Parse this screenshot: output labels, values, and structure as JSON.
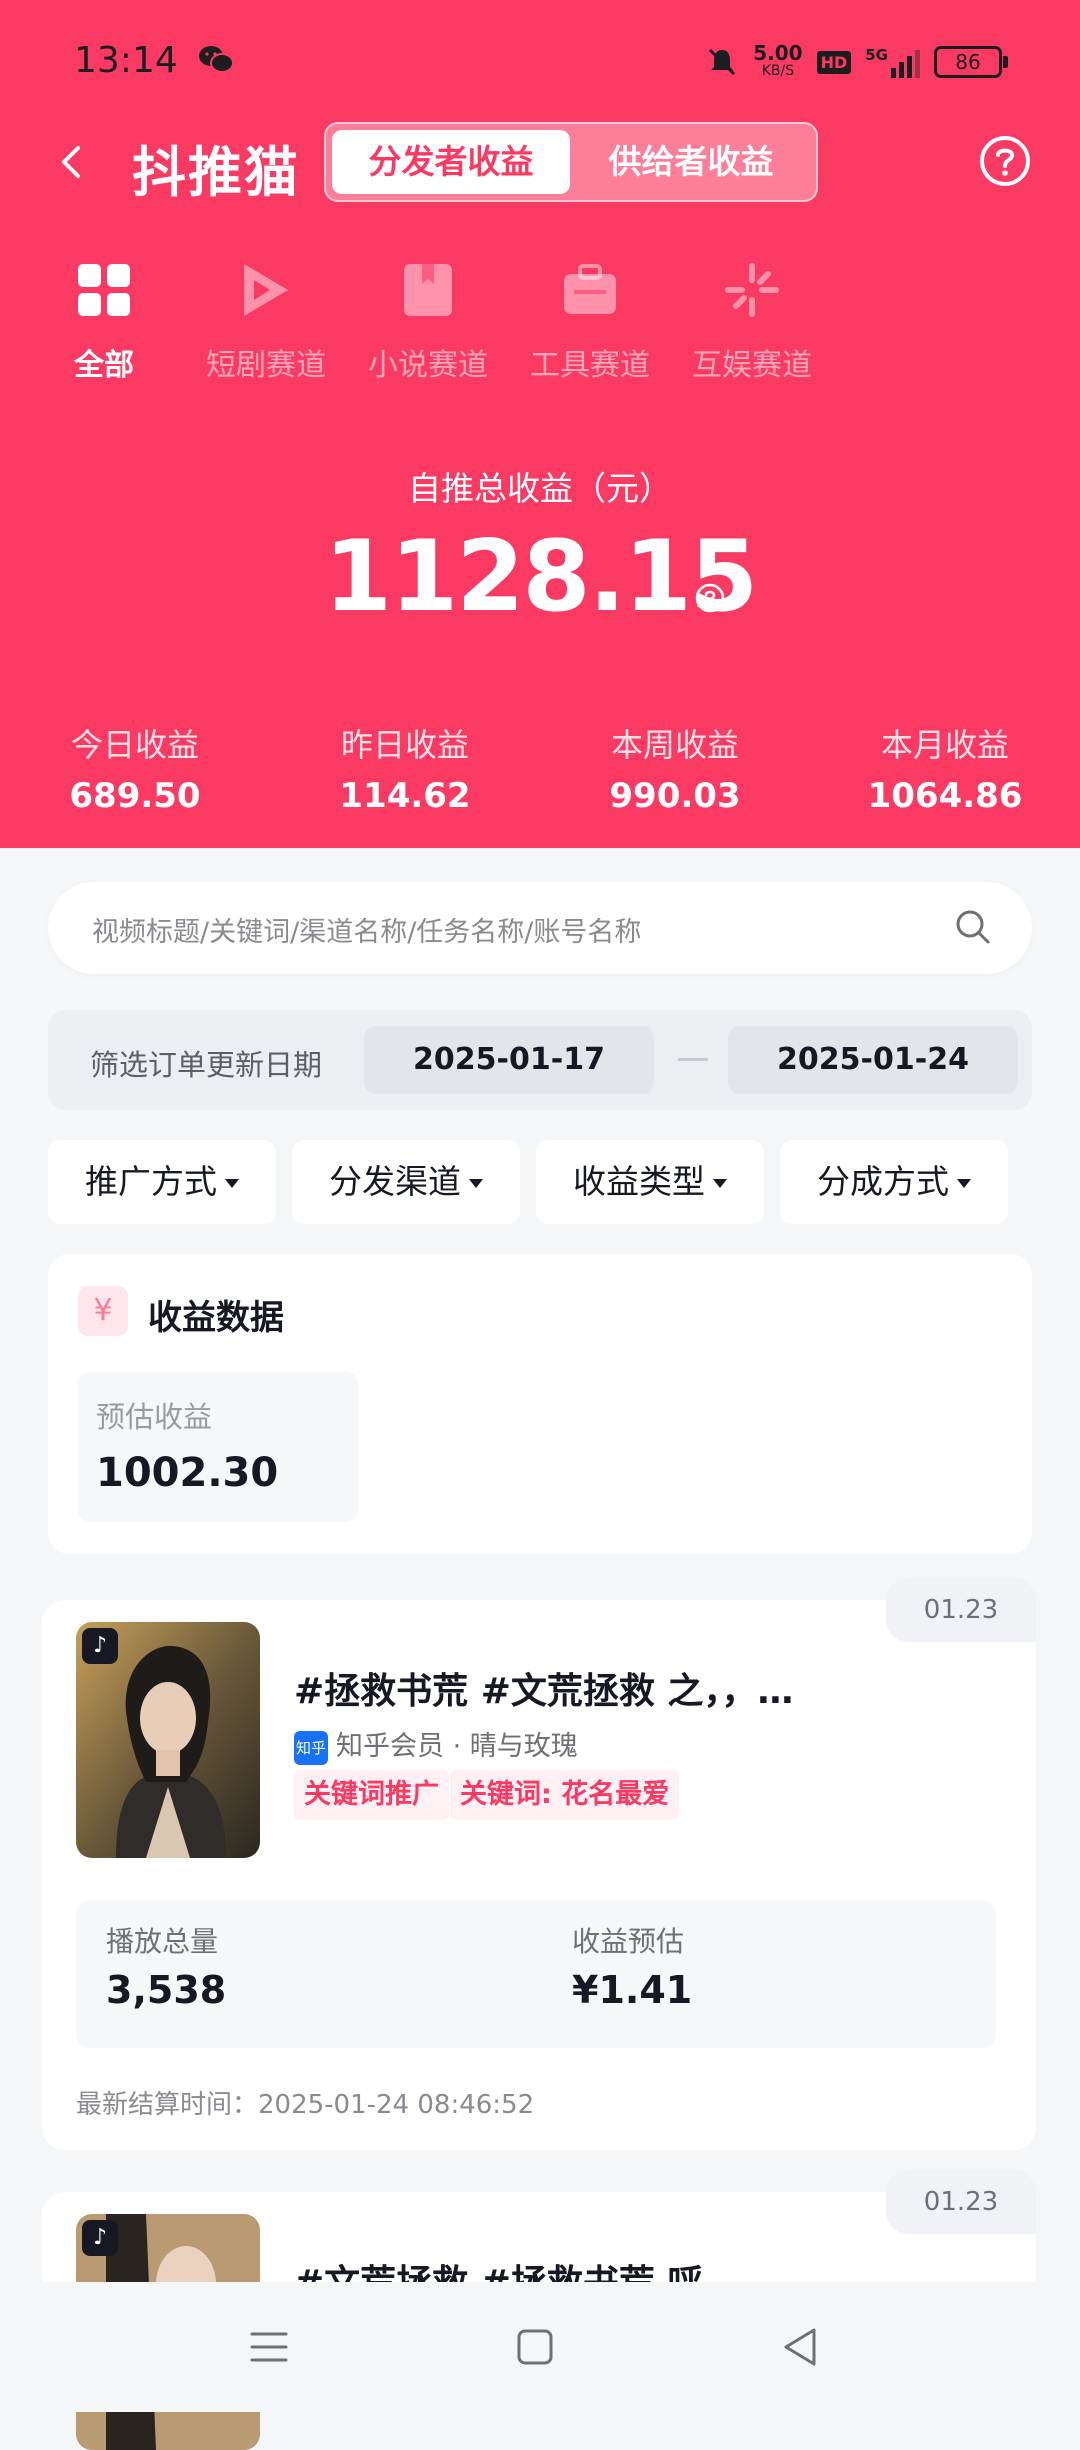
{
  "status_bar": {
    "time": "13:14",
    "net_speed": "5.00",
    "net_unit": "KB/S",
    "hd": "HD",
    "signal": "5G",
    "battery": "86"
  },
  "nav": {
    "logo": "抖推猫",
    "tabs": [
      {
        "label": "分发者收益",
        "active": true
      },
      {
        "label": "供给者收益",
        "active": false
      }
    ]
  },
  "categories": [
    {
      "label": "全部",
      "icon": "grid-icon",
      "active": true
    },
    {
      "label": "短剧赛道",
      "icon": "play-icon",
      "active": false
    },
    {
      "label": "小说赛道",
      "icon": "book-icon",
      "active": false
    },
    {
      "label": "工具赛道",
      "icon": "toolbox-icon",
      "active": false
    },
    {
      "label": "互娱赛道",
      "icon": "sparkle-icon",
      "active": false
    }
  ],
  "total": {
    "label": "自推总收益（元）",
    "value": "1128.15"
  },
  "stats": [
    {
      "label": "今日收益",
      "value": "689.50"
    },
    {
      "label": "昨日收益",
      "value": "114.62"
    },
    {
      "label": "本周收益",
      "value": "990.03"
    },
    {
      "label": "本月收益",
      "value": "1064.86"
    }
  ],
  "search": {
    "placeholder": "视频标题/关键词/渠道名称/任务名称/账号名称"
  },
  "date_filter": {
    "label": "筛选订单更新日期",
    "start": "2025-01-17",
    "end": "2025-01-24"
  },
  "filters": [
    "推广方式",
    "分发渠道",
    "收益类型",
    "分成方式"
  ],
  "earnings": {
    "yen": "¥",
    "title": "收益数据",
    "estimate_label": "预估收益",
    "estimate_value": "1002.30"
  },
  "cards": [
    {
      "date": "01.23",
      "title": "#拯救书荒 #文荒拯救 之，，…",
      "platform_badge": "知乎",
      "source": "知乎会员 · 晴与玫瑰",
      "tags": [
        "关键词推广",
        "关键词: 花名最爱"
      ],
      "plays_label": "播放总量",
      "plays_value": "3,538",
      "income_label": "收益预估",
      "income_value": "¥1.41",
      "settle": "最新结算时间：2025-01-24 08:46:52"
    },
    {
      "date": "01.23",
      "title": "#文荒拯救 #拯救书荒 呼"
    }
  ],
  "colors": {
    "brand": "#fb3a64",
    "background": "#f5f6f8"
  }
}
